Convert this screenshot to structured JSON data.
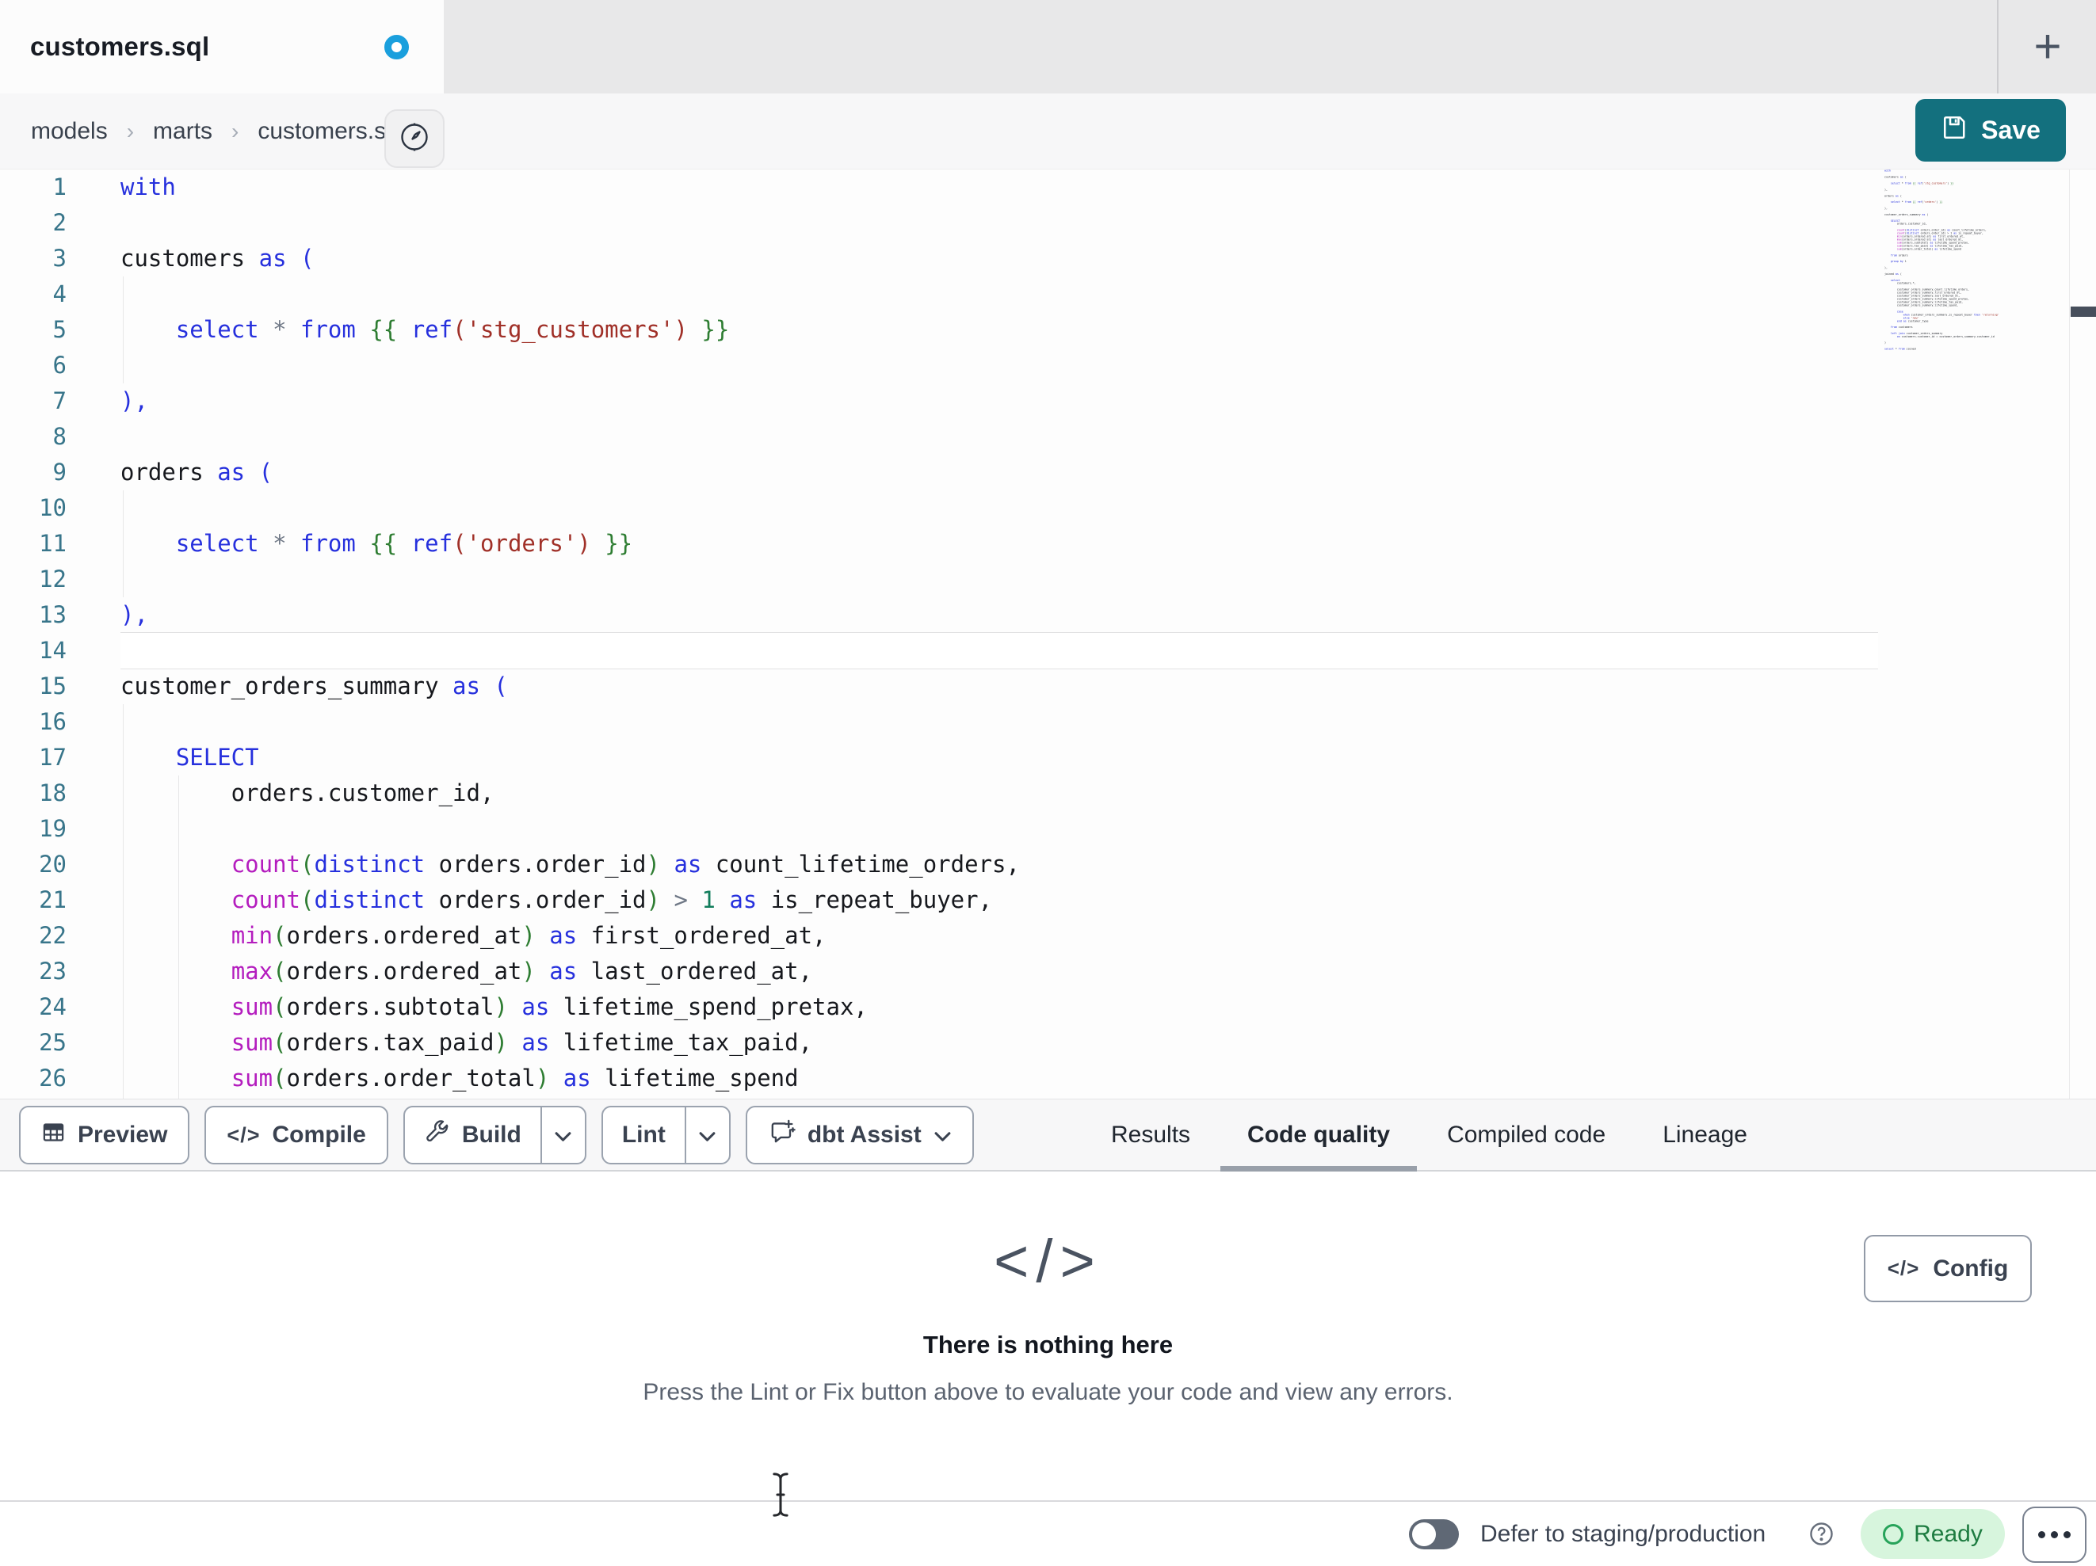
{
  "theme": {
    "save_teal": "#13707e",
    "unsaved_blue": "#1a9fdd",
    "ready_bg": "#d7f5dd",
    "ready_text": "#1e7c41",
    "ready_icon": "#27a35a"
  },
  "window": {
    "tab_title": "customers.sql",
    "new_tab": "+"
  },
  "breadcrumb": {
    "items": [
      "models",
      "marts",
      "customers.sql"
    ],
    "separator": "›"
  },
  "save_button": {
    "label": "Save"
  },
  "editor": {
    "active_line": 14,
    "colors": {
      "k": "#2630dd",
      "f": "#b41dbe",
      "s": "#a03028",
      "g": "#2e7d32",
      "o": "#6f7886",
      "n": "#127d5c",
      "t": "#16181d",
      "ln": "#38758a"
    },
    "lines": [
      [
        [
          "k",
          "with"
        ]
      ],
      [],
      [
        [
          "t",
          "customers "
        ],
        [
          "k",
          "as ("
        ]
      ],
      [],
      [
        [
          "t",
          "    "
        ],
        [
          "k",
          "select"
        ],
        [
          "t",
          " "
        ],
        [
          "o",
          "*"
        ],
        [
          "t",
          " "
        ],
        [
          "k",
          "from"
        ],
        [
          "t",
          " "
        ],
        [
          "g",
          "{{"
        ],
        [
          "t",
          " "
        ],
        [
          "k",
          "ref"
        ],
        [
          "s",
          "('stg_customers')"
        ],
        [
          "t",
          " "
        ],
        [
          "g",
          "}}"
        ]
      ],
      [],
      [
        [
          "k",
          "),"
        ]
      ],
      [],
      [
        [
          "t",
          "orders "
        ],
        [
          "k",
          "as ("
        ]
      ],
      [],
      [
        [
          "t",
          "    "
        ],
        [
          "k",
          "select"
        ],
        [
          "t",
          " "
        ],
        [
          "o",
          "*"
        ],
        [
          "t",
          " "
        ],
        [
          "k",
          "from"
        ],
        [
          "t",
          " "
        ],
        [
          "g",
          "{{"
        ],
        [
          "t",
          " "
        ],
        [
          "k",
          "ref"
        ],
        [
          "s",
          "('orders')"
        ],
        [
          "t",
          " "
        ],
        [
          "g",
          "}}"
        ]
      ],
      [],
      [
        [
          "k",
          "),"
        ]
      ],
      [],
      [
        [
          "t",
          "customer_orders_summary "
        ],
        [
          "k",
          "as ("
        ]
      ],
      [],
      [
        [
          "t",
          "    "
        ],
        [
          "k",
          "SELECT"
        ]
      ],
      [
        [
          "t",
          "        orders.customer_id,"
        ]
      ],
      [],
      [
        [
          "t",
          "        "
        ],
        [
          "f",
          "count"
        ],
        [
          "g",
          "("
        ],
        [
          "k",
          "distinct"
        ],
        [
          "t",
          " orders.order_id"
        ],
        [
          "g",
          ")"
        ],
        [
          "t",
          " "
        ],
        [
          "k",
          "as"
        ],
        [
          "t",
          " count_lifetime_orders,"
        ]
      ],
      [
        [
          "t",
          "        "
        ],
        [
          "f",
          "count"
        ],
        [
          "g",
          "("
        ],
        [
          "k",
          "distinct"
        ],
        [
          "t",
          " orders.order_id"
        ],
        [
          "g",
          ")"
        ],
        [
          "t",
          " "
        ],
        [
          "o",
          ">"
        ],
        [
          "t",
          " "
        ],
        [
          "n",
          "1"
        ],
        [
          "t",
          " "
        ],
        [
          "k",
          "as"
        ],
        [
          "t",
          " is_repeat_buyer,"
        ]
      ],
      [
        [
          "t",
          "        "
        ],
        [
          "f",
          "min"
        ],
        [
          "g",
          "("
        ],
        [
          "t",
          "orders.ordered_at"
        ],
        [
          "g",
          ")"
        ],
        [
          "t",
          " "
        ],
        [
          "k",
          "as"
        ],
        [
          "t",
          " first_ordered_at,"
        ]
      ],
      [
        [
          "t",
          "        "
        ],
        [
          "f",
          "max"
        ],
        [
          "g",
          "("
        ],
        [
          "t",
          "orders.ordered_at"
        ],
        [
          "g",
          ")"
        ],
        [
          "t",
          " "
        ],
        [
          "k",
          "as"
        ],
        [
          "t",
          " last_ordered_at,"
        ]
      ],
      [
        [
          "t",
          "        "
        ],
        [
          "f",
          "sum"
        ],
        [
          "g",
          "("
        ],
        [
          "t",
          "orders.subtotal"
        ],
        [
          "g",
          ")"
        ],
        [
          "t",
          " "
        ],
        [
          "k",
          "as"
        ],
        [
          "t",
          " lifetime_spend_pretax,"
        ]
      ],
      [
        [
          "t",
          "        "
        ],
        [
          "f",
          "sum"
        ],
        [
          "g",
          "("
        ],
        [
          "t",
          "orders.tax_paid"
        ],
        [
          "g",
          ")"
        ],
        [
          "t",
          " "
        ],
        [
          "k",
          "as"
        ],
        [
          "t",
          " lifetime_tax_paid,"
        ]
      ],
      [
        [
          "t",
          "        "
        ],
        [
          "f",
          "sum"
        ],
        [
          "g",
          "("
        ],
        [
          "t",
          "orders.order_total"
        ],
        [
          "g",
          ")"
        ],
        [
          "t",
          " "
        ],
        [
          "k",
          "as"
        ],
        [
          "t",
          " lifetime_spend"
        ]
      ]
    ],
    "minimap_code": "with\n\ncustomers as (\n\n    select * from {{ ref('stg_customers') }}\n\n),\n\norders as (\n\n    select * from {{ ref('orders') }}\n\n),\n\ncustomer_orders_summary as (\n\n    SELECT\n        orders.customer_id,\n\n        count(distinct orders.order_id) as count_lifetime_orders,\n        count(distinct orders.order_id) > 1 as is_repeat_buyer,\n        min(orders.ordered_at) as first_ordered_at,\n        max(orders.ordered_at) as last_ordered_at,\n        sum(orders.subtotal) as lifetime_spend_pretax,\n        sum(orders.tax_paid) as lifetime_tax_paid,\n        sum(orders.order_total) as lifetime_spend\n\n    from orders\n\n    group by 1\n\n),\n\njoined as (\n\n    select\n        customers.*,\n\n        customer_orders_summary.count_lifetime_orders,\n        customer_orders_summary.first_ordered_at,\n        customer_orders_summary.last_ordered_at,\n        customer_orders_summary.lifetime_spend_pretax,\n        customer_orders_summary.lifetime_tax_paid,\n        customer_orders_summary.lifetime_spend,\n\n        case\n            when customer_orders_summary.is_repeat_buyer then 'returning'\n            else 'new'\n        end as customer_type\n\n    from customers\n\n    left join customer_orders_summary\n        on customers.customer_id = customer_orders_summary.customer_id\n\n)\n\nselect * from joined"
  },
  "toolbar": {
    "buttons": {
      "preview": "Preview",
      "compile": "Compile",
      "build": "Build",
      "lint": "Lint",
      "assist": "dbt Assist"
    },
    "code_glyph": "</>"
  },
  "panel": {
    "tabs": [
      {
        "label": "Results",
        "active": false
      },
      {
        "label": "Code quality",
        "active": true
      },
      {
        "label": "Compiled code",
        "active": false
      },
      {
        "label": "Lineage",
        "active": false
      }
    ],
    "empty_icon": "</>",
    "empty_title": "There is nothing here",
    "empty_description": "Press the Lint or Fix button above to evaluate your code and view any errors.",
    "config_label": "Config"
  },
  "status_bar": {
    "defer_label": "Defer to staging/production",
    "ready_label": "Ready",
    "toggle_on": false
  }
}
